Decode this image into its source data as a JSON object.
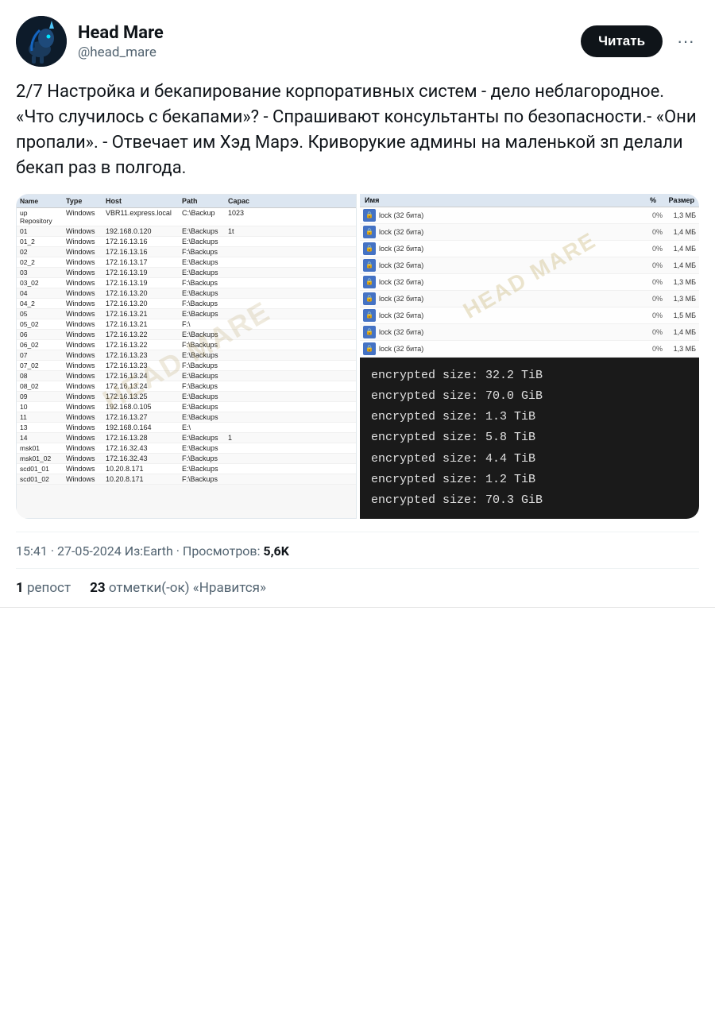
{
  "author": {
    "name": "Head Mare",
    "handle": "@head_mare",
    "follow_label": "Читать"
  },
  "tweet": {
    "text": "2/7 Настройка и бекапирование корпоративных систем -  дело неблагородное. «Что случилось с бекапами»? - Спрашивают консультанты по безопасности.- «Они пропали». - Отвечает им Хэд Марэ. Криворукие админы на маленькой зп делали бекап раз в полгода.",
    "meta": "15:41 · 27-05-2024 Из:Earth · Просмотров:",
    "views": "5,6K",
    "reposts_label": "репост",
    "reposts_count": "1",
    "likes_label": "отметки(-ок) «Нравится»",
    "likes_count": "23"
  },
  "watermark": "HEAD MARE",
  "veeam": {
    "columns": [
      "",
      "Type",
      "Host",
      "Path",
      "Capaci"
    ],
    "rows": [
      [
        "up Repository",
        "Windows",
        "VBR11.express.local",
        "C:\\Backup",
        "1023"
      ],
      [
        "01",
        "Windows",
        "192.168.0.120",
        "E:\\Backups",
        "1t"
      ],
      [
        "01_2",
        "Windows",
        "172.16.13.16",
        "E:\\Backups",
        ""
      ],
      [
        "02",
        "Windows",
        "172.16.13.16",
        "F:\\Backups",
        ""
      ],
      [
        "02_2",
        "Windows",
        "172.16.13.17",
        "E:\\Backups",
        ""
      ],
      [
        "03",
        "Windows",
        "172.16.13.19",
        "E:\\Backups",
        ""
      ],
      [
        "03_02",
        "Windows",
        "172.16.13.19",
        "F:\\Backups",
        ""
      ],
      [
        "04",
        "Windows",
        "172.16.13.20",
        "E:\\Backups",
        ""
      ],
      [
        "04_2",
        "Windows",
        "172.16.13.20",
        "F:\\Backups",
        ""
      ],
      [
        "05",
        "Windows",
        "172.16.13.21",
        "E:\\Backups",
        ""
      ],
      [
        "05_02",
        "Windows",
        "172.16.13.21",
        "F:\\",
        ""
      ],
      [
        "06",
        "Windows",
        "172.16.13.22",
        "E:\\Backups",
        ""
      ],
      [
        "06_02",
        "Windows",
        "172.16.13.22",
        "F:\\Backups",
        ""
      ],
      [
        "07",
        "Windows",
        "172.16.13.23",
        "E:\\Backups",
        ""
      ],
      [
        "07_02",
        "Windows",
        "172.16.13.23",
        "F:\\Backups",
        ""
      ],
      [
        "08",
        "Windows",
        "172.16.13.24",
        "E:\\Backups",
        ""
      ],
      [
        "08_02",
        "Windows",
        "172.16.13.24",
        "F:\\Backups",
        ""
      ],
      [
        "09",
        "Windows",
        "172.16.13.25",
        "E:\\Backups",
        ""
      ],
      [
        "10",
        "Windows",
        "192.168.0.105",
        "E:\\Backups",
        ""
      ],
      [
        "11",
        "Windows",
        "172.16.13.27",
        "E:\\Backups",
        ""
      ],
      [
        "13",
        "Windows",
        "192.168.0.164",
        "E:\\",
        ""
      ],
      [
        "14",
        "Windows",
        "172.16.13.28",
        "E:\\Backups",
        "1"
      ],
      [
        "msk01",
        "Windows",
        "172.16.32.43",
        "E:\\Backups",
        ""
      ],
      [
        "msk01_02",
        "Windows",
        "172.16.32.43",
        "F:\\Backups",
        ""
      ],
      [
        "scd01_01",
        "Windows",
        "10.20.8.171",
        "E:\\Backups",
        ""
      ],
      [
        "scd01_02",
        "Windows",
        "10.20.8.171",
        "F:\\Backups",
        ""
      ]
    ]
  },
  "lock_files": {
    "header": [
      "Name",
      "",
      "%",
      "Size"
    ],
    "rows": [
      {
        "name": "lock (32 бита)",
        "pct": "0%",
        "size": "1,3 МБ"
      },
      {
        "name": "lock (32 бита)",
        "pct": "0%",
        "size": "1,4 МБ"
      },
      {
        "name": "lock (32 бита)",
        "pct": "0%",
        "size": "1,4 МБ"
      },
      {
        "name": "lock (32 бита)",
        "pct": "0%",
        "size": "1,4 МБ"
      },
      {
        "name": "lock (32 бита)",
        "pct": "0%",
        "size": "1,3 МБ"
      },
      {
        "name": "lock (32 бита)",
        "pct": "0%",
        "size": "1,3 МБ"
      },
      {
        "name": "lock (32 бита)",
        "pct": "0%",
        "size": "1,5 МБ"
      },
      {
        "name": "lock (32 бита)",
        "pct": "0%",
        "size": "1,4 МБ"
      },
      {
        "name": "lock (32 бита)",
        "pct": "0%",
        "size": "1,3 МБ"
      }
    ]
  },
  "encrypted": {
    "lines": [
      "encrypted size: 32.2 TiB",
      "encrypted size: 70.0 GiB",
      "encrypted size: 1.3 TiB",
      "encrypted size: 5.8 TiB",
      "encrypted size: 4.4 TiB",
      "encrypted size: 1.2 TiB",
      "encrypted size: 70.3 GiB"
    ]
  }
}
